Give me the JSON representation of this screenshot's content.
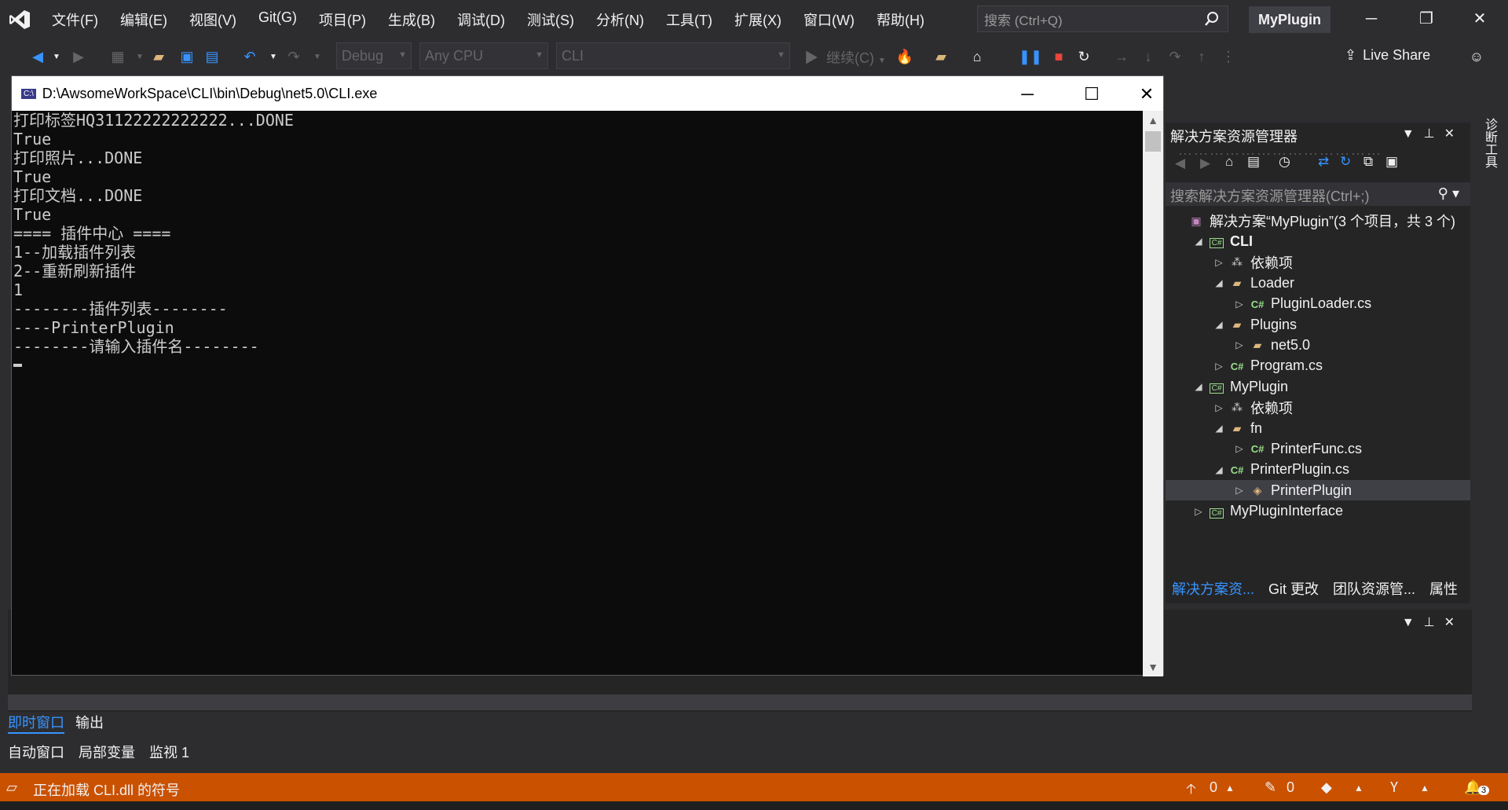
{
  "menu": {
    "items": [
      "文件(F)",
      "编辑(E)",
      "视图(V)",
      "Git(G)",
      "项目(P)",
      "生成(B)",
      "调试(D)",
      "测试(S)",
      "分析(N)",
      "工具(T)",
      "扩展(X)",
      "窗口(W)",
      "帮助(H)"
    ],
    "search_placeholder": "搜索 (Ctrl+Q)",
    "solution_name": "MyPlugin"
  },
  "toolbar": {
    "config": "Debug",
    "platform": "Any CPU",
    "startup_project": "CLI",
    "continue_label": "继续(C)",
    "live_share": "Live Share"
  },
  "console": {
    "title": "D:\\AwsomeWorkSpace\\CLI\\bin\\Debug\\net5.0\\CLI.exe",
    "lines": [
      "打印标签HQ31122222222222...DONE",
      "True",
      "打印照片...DONE",
      "True",
      "打印文档...DONE",
      "True",
      "==== 插件中心 ====",
      "1--加载插件列表",
      "2--重新刷新插件",
      "1",
      "--------插件列表--------",
      "----PrinterPlugin",
      "--------请输入插件名--------"
    ]
  },
  "solution_explorer": {
    "title": "解决方案资源管理器",
    "search_placeholder": "搜索解决方案资源管理器(Ctrl+;)",
    "tree": [
      {
        "label": "解决方案“MyPlugin”(3 个项目，共 3 个)",
        "indent": 0,
        "arrow": "",
        "icon": "solution"
      },
      {
        "label": "CLI",
        "indent": 1,
        "arrow": "down",
        "icon": "project",
        "bold": true
      },
      {
        "label": "依赖项",
        "indent": 2,
        "arrow": "right",
        "icon": "deps"
      },
      {
        "label": "Loader",
        "indent": 2,
        "arrow": "down",
        "icon": "folder-open"
      },
      {
        "label": "PluginLoader.cs",
        "indent": 3,
        "arrow": "right",
        "icon": "cs"
      },
      {
        "label": "Plugins",
        "indent": 2,
        "arrow": "down",
        "icon": "folder-open"
      },
      {
        "label": "net5.0",
        "indent": 3,
        "arrow": "right",
        "icon": "folder"
      },
      {
        "label": "Program.cs",
        "indent": 2,
        "arrow": "right",
        "icon": "cs"
      },
      {
        "label": "MyPlugin",
        "indent": 1,
        "arrow": "down",
        "icon": "project"
      },
      {
        "label": "依赖项",
        "indent": 2,
        "arrow": "right",
        "icon": "deps"
      },
      {
        "label": "fn",
        "indent": 2,
        "arrow": "down",
        "icon": "folder-open"
      },
      {
        "label": "PrinterFunc.cs",
        "indent": 3,
        "arrow": "right",
        "icon": "cs"
      },
      {
        "label": "PrinterPlugin.cs",
        "indent": 2,
        "arrow": "down",
        "icon": "cs"
      },
      {
        "label": "PrinterPlugin",
        "indent": 3,
        "arrow": "right",
        "icon": "class",
        "selected": true
      },
      {
        "label": "MyPluginInterface",
        "indent": 1,
        "arrow": "right",
        "icon": "project"
      }
    ],
    "tabs": [
      "解决方案资...",
      "Git 更改",
      "团队资源管...",
      "属性"
    ]
  },
  "side_tab": "诊断工具",
  "bottom_tabs": [
    "即时窗口",
    "输出"
  ],
  "bottom_tabs2": [
    "自动窗口",
    "局部变量",
    "监视 1"
  ],
  "status": {
    "message": "正在加载 CLI.dll 的符号",
    "up_count": "0",
    "pencil_count": "0",
    "notif_count": "3"
  },
  "colors": {
    "statusbar": "#ca5100",
    "accent": "#3794ff",
    "ide_bg": "#2d2d30",
    "console_bg": "#0c0c0c"
  }
}
